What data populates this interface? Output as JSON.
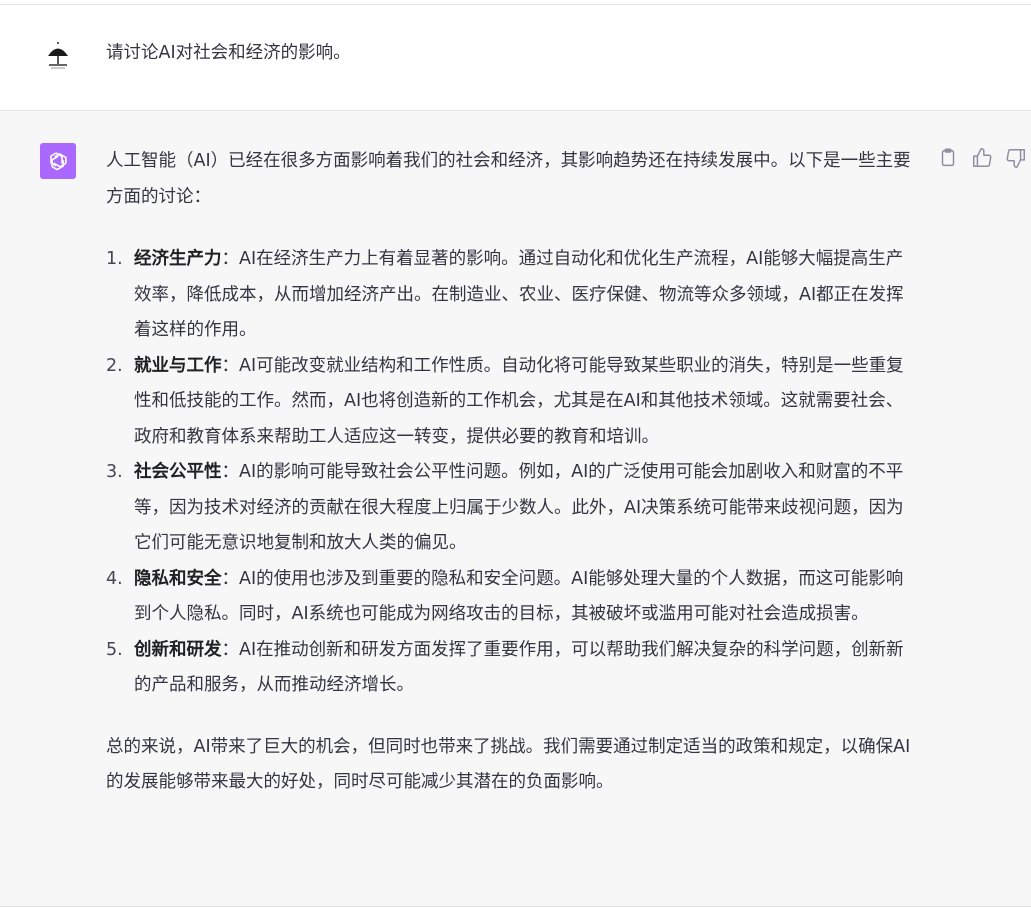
{
  "user": {
    "avatar_icon": "umbrella-avatar-icon",
    "message": "请讨论AI对社会和经济的影响。"
  },
  "assistant": {
    "avatar_icon": "openai-logo-icon",
    "avatar_color": "#ab68ff",
    "intro": "人工智能（AI）已经在很多方面影响着我们的社会和经济，其影响趋势还在持续发展中。以下是一些主要方面的讨论：",
    "points": [
      {
        "num": "1.",
        "title": "经济生产力",
        "sep": "：",
        "text": "AI在经济生产力上有着显著的影响。通过自动化和优化生产流程，AI能够大幅提高生产效率，降低成本，从而增加经济产出。在制造业、农业、医疗保健、物流等众多领域，AI都正在发挥着这样的作用。"
      },
      {
        "num": "2.",
        "title": "就业与工作",
        "sep": "：",
        "text": "AI可能改变就业结构和工作性质。自动化将可能导致某些职业的消失，特别是一些重复性和低技能的工作。然而，AI也将创造新的工作机会，尤其是在AI和其他技术领域。这就需要社会、政府和教育体系来帮助工人适应这一转变，提供必要的教育和培训。"
      },
      {
        "num": "3.",
        "title": "社会公平性",
        "sep": "：",
        "text": "AI的影响可能导致社会公平性问题。例如，AI的广泛使用可能会加剧收入和财富的不平等，因为技术对经济的贡献在很大程度上归属于少数人。此外，AI决策系统可能带来歧视问题，因为它们可能无意识地复制和放大人类的偏见。"
      },
      {
        "num": "4.",
        "title": "隐私和安全",
        "sep": "：",
        "text": "AI的使用也涉及到重要的隐私和安全问题。AI能够处理大量的个人数据，而这可能影响到个人隐私。同时，AI系统也可能成为网络攻击的目标，其被破坏或滥用可能对社会造成损害。"
      },
      {
        "num": "5.",
        "title": "创新和研发",
        "sep": "：",
        "text": "AI在推动创新和研发方面发挥了重要作用，可以帮助我们解决复杂的科学问题，创新新的产品和服务，从而推动经济增长。"
      }
    ],
    "conclusion": "总的来说，AI带来了巨大的机会，但同时也带来了挑战。我们需要通过制定适当的政策和规定，以确保AI的发展能够带来最大的好处，同时尽可能减少其潜在的负面影响。",
    "actions": [
      "copy-icon",
      "thumbs-up-icon",
      "thumbs-down-icon"
    ]
  }
}
